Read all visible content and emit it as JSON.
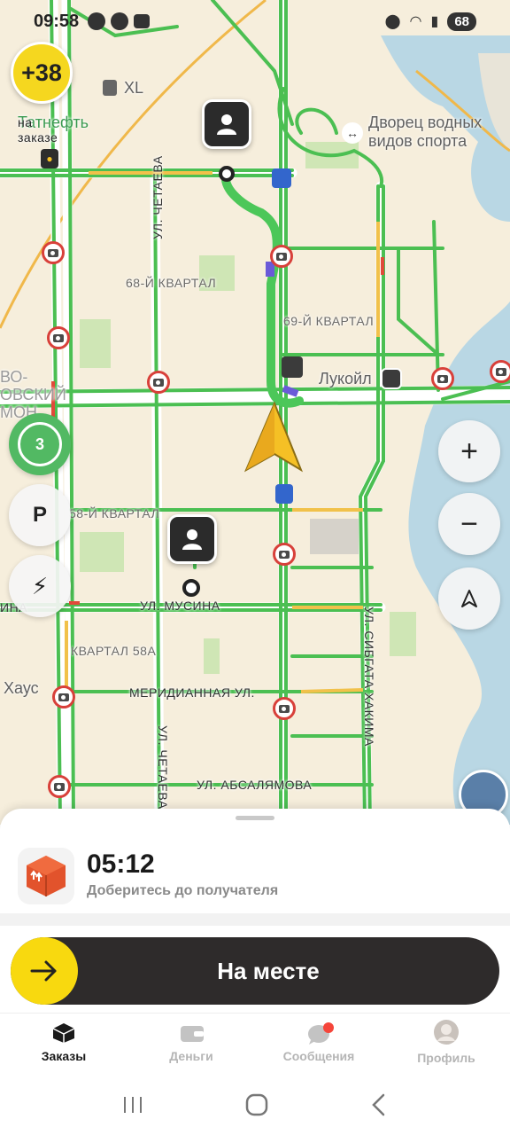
{
  "status_bar": {
    "time": "09:58",
    "battery": "68"
  },
  "map": {
    "score_badge": "+38",
    "labels": {
      "xl": "XL",
      "tatneft_top": "Татнефть",
      "na_zakaze": "на\nзаказе",
      "dvorets": "Дворец водных\nвидов спорта",
      "kvartal68": "68-Й КВАРТАЛ",
      "kvartal69": "69-Й КВАРТАЛ",
      "lukoil": "Лукойл",
      "kvartal58": "58-Й КВАРТАЛ",
      "kvartal58a": "КВАРТАЛ 58А",
      "chetaeva_top": "УЛ. ЧЕТАЕВА",
      "chetaeva_bottom": "УЛ. ЧЕТАЕВА",
      "musina": "УЛ. МУСИНА",
      "meridiannaya": "МЕРИДИАННАЯ УЛ.",
      "absalyamova": "УЛ. АБСАЛЯМОВА",
      "sibgata": "УЛ. СИБГАТА ХАКИМА",
      "xaus": "Хаус",
      "ina": "ИНА",
      "vo_left": "ВО-\nОВСКИЙ\nМОН"
    },
    "left_buttons": {
      "layers_count": "3",
      "parking": "P"
    },
    "zoom_in": "+",
    "zoom_out": "−"
  },
  "sheet": {
    "eta": "05:12",
    "eta_subtitle": "Доберитесь до получателя",
    "action_label": "На месте"
  },
  "tabs": [
    {
      "label": "Заказы",
      "icon": "box-icon",
      "active": true
    },
    {
      "label": "Деньги",
      "icon": "wallet-icon",
      "active": false
    },
    {
      "label": "Сообщения",
      "icon": "chat-icon",
      "active": false
    },
    {
      "label": "Профиль",
      "icon": "avatar-icon",
      "active": false
    }
  ],
  "colors": {
    "accent_yellow": "#f8d90f",
    "route_green": "#3fbf4d",
    "map_bg": "#f6eedc",
    "water": "#b9d7e4"
  }
}
